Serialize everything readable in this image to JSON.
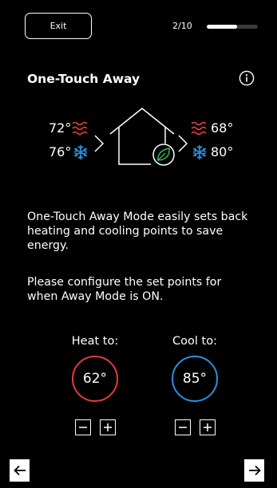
{
  "header": {
    "exit_label": "Exit",
    "progress_text": "2/10",
    "progress_fraction": 0.6
  },
  "title": "One-Touch Away",
  "icons": {
    "info": "info-icon",
    "heat": "heat-waves-icon",
    "cool": "snowflake-icon",
    "house": "house-leaf-icon",
    "back": "arrow-left-icon",
    "next": "arrow-right-icon"
  },
  "diagram": {
    "left_heat": "72°",
    "left_cool": "76°",
    "right_heat": "68°",
    "right_cool": "80°"
  },
  "description": {
    "paragraph1": "One-Touch Away Mode easily sets back heating and cooling points to save energy.",
    "paragraph2": "Please configure the set points for when Away Mode is ON."
  },
  "setpoints": {
    "heat": {
      "label": "Heat to:",
      "value": "62°"
    },
    "cool": {
      "label": "Cool to:",
      "value": "85°"
    }
  },
  "colors": {
    "heat": "#e5393f",
    "cool": "#2c8fde",
    "leaf": "#3fae49",
    "background": "#000000"
  }
}
